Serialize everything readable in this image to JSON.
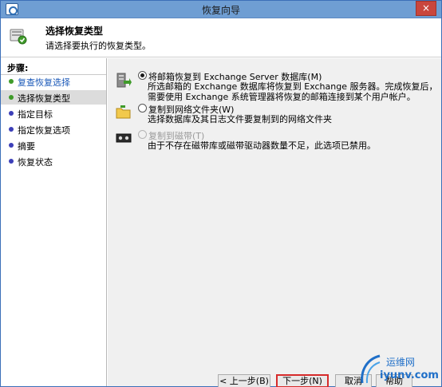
{
  "window": {
    "title": "恢复向导",
    "close_symbol": "×",
    "icon": "wizard-app-icon"
  },
  "header": {
    "title": "选择恢复类型",
    "subtitle": "请选择要执行的恢复类型。",
    "icon": "recovery-type-icon"
  },
  "steps": {
    "title": "步骤:",
    "items": [
      {
        "label": "复查恢复选择",
        "state": "done"
      },
      {
        "label": "选择恢复类型",
        "state": "current"
      },
      {
        "label": "指定目标",
        "state": "pending"
      },
      {
        "label": "指定恢复选项",
        "state": "pending"
      },
      {
        "label": "摘要",
        "state": "pending"
      },
      {
        "label": "恢复状态",
        "state": "pending"
      }
    ]
  },
  "options": [
    {
      "icon": "exchange-server-icon",
      "label": "将邮箱恢复到 Exchange Server 数据库(M)",
      "description": "所选邮箱的 Exchange 数据库将恢复到 Exchange 服务器。完成恢复后，需要使用 Exchange 系统管理器将恢复的邮箱连接到某个用户帐户。",
      "selected": true,
      "enabled": true
    },
    {
      "icon": "network-folder-icon",
      "label": "复制到网络文件夹(W)",
      "description": "选择数据库及其日志文件要复制到的网络文件夹",
      "selected": false,
      "enabled": true
    },
    {
      "icon": "tape-drive-icon",
      "label": "复制到磁带(T)",
      "description": "由于不存在磁带库或磁带驱动器数量不足，此选项已禁用。",
      "selected": false,
      "enabled": false
    }
  ],
  "buttons": {
    "back": "< 上一步(B)",
    "next": "下一步(N) >",
    "cancel": "取消",
    "help": "帮助"
  },
  "watermark": {
    "line1": "运维网",
    "line2": "iyunv.com"
  },
  "colors": {
    "titlebar": "#6f9ed3",
    "close_button": "#c9463d",
    "step_done_dot": "#3f9b2a",
    "step_pending_dot": "#3c3fb8",
    "step_done_text": "#1a58b8",
    "next_button_highlight": "#d62b2b"
  }
}
